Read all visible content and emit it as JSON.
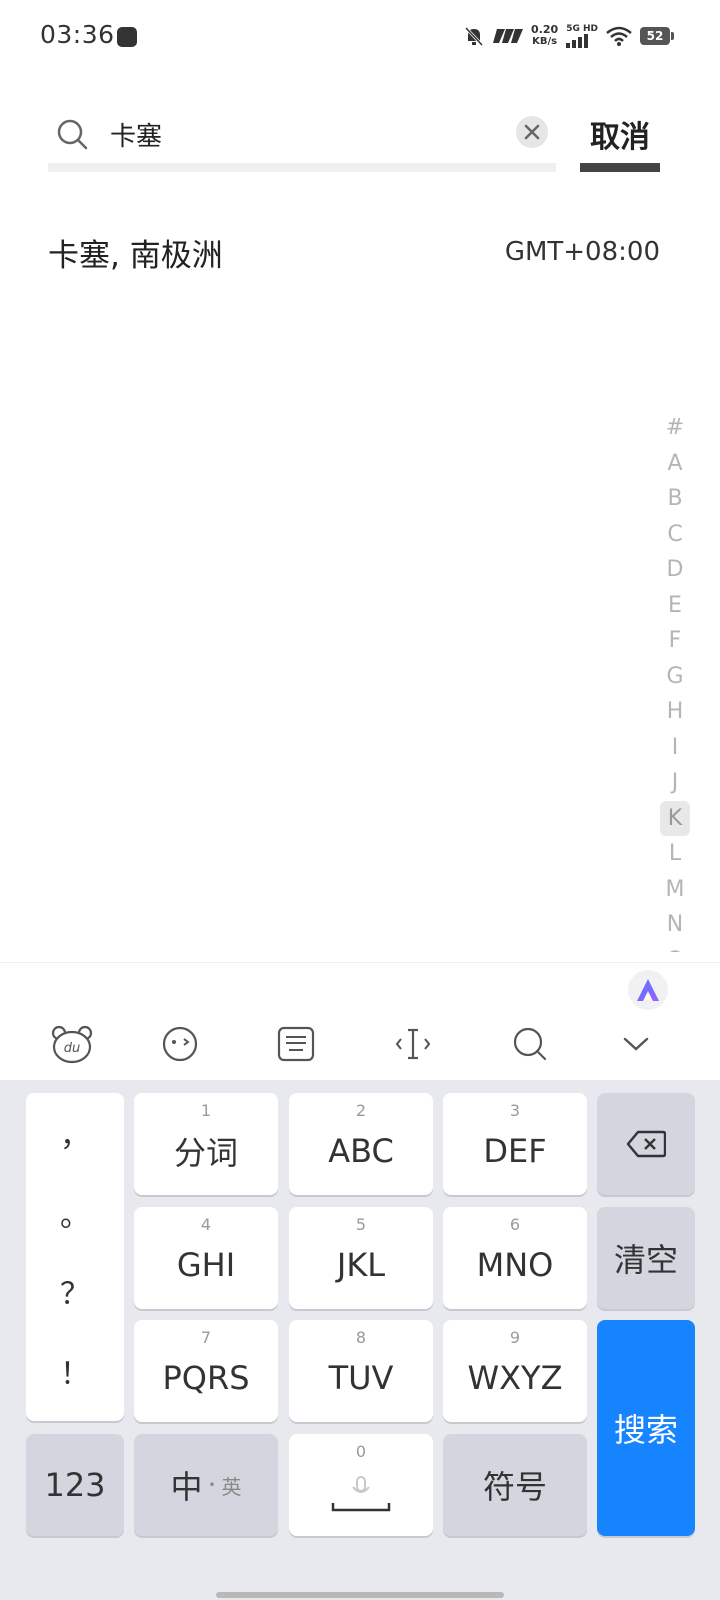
{
  "status_bar": {
    "time": "03:36",
    "net_speed_value": "0.20",
    "net_speed_unit": "KB/s",
    "net_5g": "5G",
    "net_hd": "HD",
    "battery": "52"
  },
  "search": {
    "query": "卡塞",
    "cancel_label": "取消"
  },
  "results": [
    {
      "city": "卡塞, 南极洲",
      "timezone": "GMT+08:00"
    }
  ],
  "alpha_index": [
    "#",
    "A",
    "B",
    "C",
    "D",
    "E",
    "F",
    "G",
    "H",
    "I",
    "J",
    "K",
    "L",
    "M",
    "N",
    "O"
  ],
  "alpha_active": "K",
  "keyboard": {
    "punctuation": [
      "，",
      "。",
      "？",
      "！"
    ],
    "rows": [
      [
        {
          "num": "1",
          "label": "分词"
        },
        {
          "num": "2",
          "label": "ABC"
        },
        {
          "num": "3",
          "label": "DEF"
        }
      ],
      [
        {
          "num": "4",
          "label": "GHI"
        },
        {
          "num": "5",
          "label": "JKL"
        },
        {
          "num": "6",
          "label": "MNO"
        }
      ],
      [
        {
          "num": "7",
          "label": "PQRS"
        },
        {
          "num": "8",
          "label": "TUV"
        },
        {
          "num": "9",
          "label": "WXYZ"
        }
      ]
    ],
    "clear_label": "清空",
    "search_label": "搜索",
    "num_label": "123",
    "lang_primary": "中",
    "lang_secondary": "英",
    "space_num": "0",
    "symbol_label": "符号"
  },
  "colors": {
    "accent_blue": "#1684ff",
    "key_gray": "#d3d6de",
    "keyboard_bg": "#e7e9ee"
  }
}
